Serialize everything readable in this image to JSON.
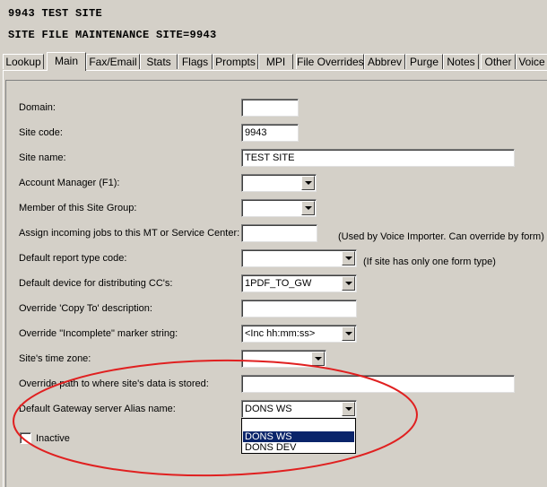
{
  "header": {
    "line1": "9943  TEST SITE",
    "line2": "SITE FILE MAINTENANCE    SITE=9943"
  },
  "tabs": [
    {
      "label": "Lookup"
    },
    {
      "label": "Main",
      "active": true
    },
    {
      "label": "Fax/Email"
    },
    {
      "label": "Stats"
    },
    {
      "label": "Flags"
    },
    {
      "label": "Prompts"
    },
    {
      "label": "MPI"
    },
    {
      "label": "File Overrides"
    },
    {
      "label": "Abbrev"
    },
    {
      "label": "Purge"
    },
    {
      "label": "Notes"
    },
    {
      "label": "Other"
    },
    {
      "label": "Voice"
    }
  ],
  "fields": {
    "domain": {
      "label": "Domain:",
      "value": ""
    },
    "site_code": {
      "label": "Site code:",
      "value": "9943"
    },
    "site_name": {
      "label": "Site name:",
      "value": "TEST SITE"
    },
    "account_manager": {
      "label": "Account Manager (F1):",
      "value": ""
    },
    "site_group": {
      "label": "Member of this Site Group:",
      "value": ""
    },
    "assign_jobs": {
      "label": "Assign incoming jobs to this MT or Service Center:",
      "value": "",
      "note": "(Used by Voice Importer.  Can override by form)"
    },
    "report_type": {
      "label": "Default report type code:",
      "value": "",
      "note": "(If site has only one form type)"
    },
    "default_device": {
      "label": "Default device for distributing CC's:",
      "value": "1PDF_TO_GW"
    },
    "copy_to": {
      "label": "Override 'Copy To' description:",
      "value": ""
    },
    "incomplete_marker": {
      "label": "Override \"Incomplete\" marker string:",
      "value": "<Inc hh:mm:ss>"
    },
    "time_zone": {
      "label": "Site's time zone:",
      "value": ""
    },
    "data_path": {
      "label": "Override path to where site's data is stored:",
      "value": ""
    },
    "gateway_alias": {
      "label": "Default Gateway server Alias name:",
      "value": "DONS WS",
      "options": [
        "",
        "DONS WS",
        "DONS DEV"
      ],
      "selected": "DONS WS"
    },
    "inactive": {
      "label": "Inactive",
      "checked": false
    }
  }
}
